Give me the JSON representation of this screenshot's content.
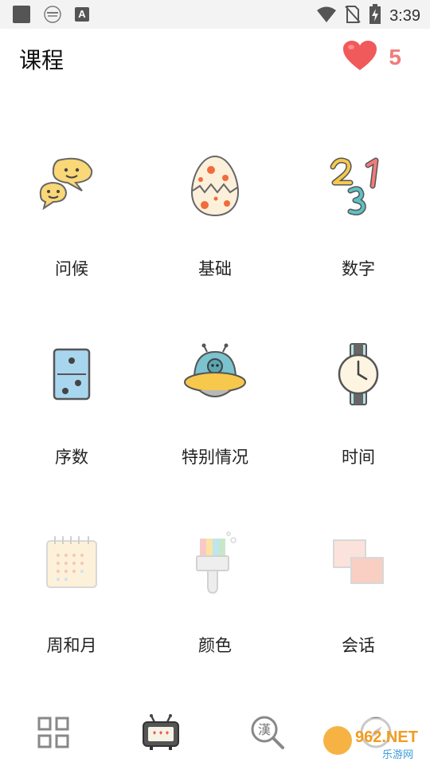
{
  "status_bar": {
    "time": "3:39",
    "notification_icons": [
      "app-square-icon",
      "recorder-badge-icon",
      "a-letter-icon"
    ],
    "system_icons": [
      "wifi-icon",
      "no-sim-icon",
      "battery-charging-icon"
    ]
  },
  "header": {
    "title": "课程",
    "lives_icon": "heart-icon",
    "lives_count": "5",
    "accent_color": "#f27b7b"
  },
  "courses": [
    {
      "label": "问候",
      "icon": "speech-bubbles-icon"
    },
    {
      "label": "基础",
      "icon": "cracked-egg-icon"
    },
    {
      "label": "数字",
      "icon": "numbers-icon"
    },
    {
      "label": "序数",
      "icon": "domino-icon"
    },
    {
      "label": "特别情况",
      "icon": "ufo-icon"
    },
    {
      "label": "时间",
      "icon": "wristwatch-icon"
    },
    {
      "label": "周和月",
      "icon": "calendar-icon",
      "locked": true
    },
    {
      "label": "颜色",
      "icon": "paintbrush-icon",
      "locked": true
    },
    {
      "label": "会话",
      "icon": "conversation-cards-icon",
      "locked": true
    }
  ],
  "bottom_nav": [
    {
      "icon": "grid-icon",
      "active": false
    },
    {
      "icon": "tv-icon",
      "active": true
    },
    {
      "icon": "han-magnifier-icon",
      "active": false
    },
    {
      "icon": "compass-icon",
      "active": false
    }
  ],
  "watermark": {
    "brand": "962.NET",
    "sub": "乐游网"
  }
}
